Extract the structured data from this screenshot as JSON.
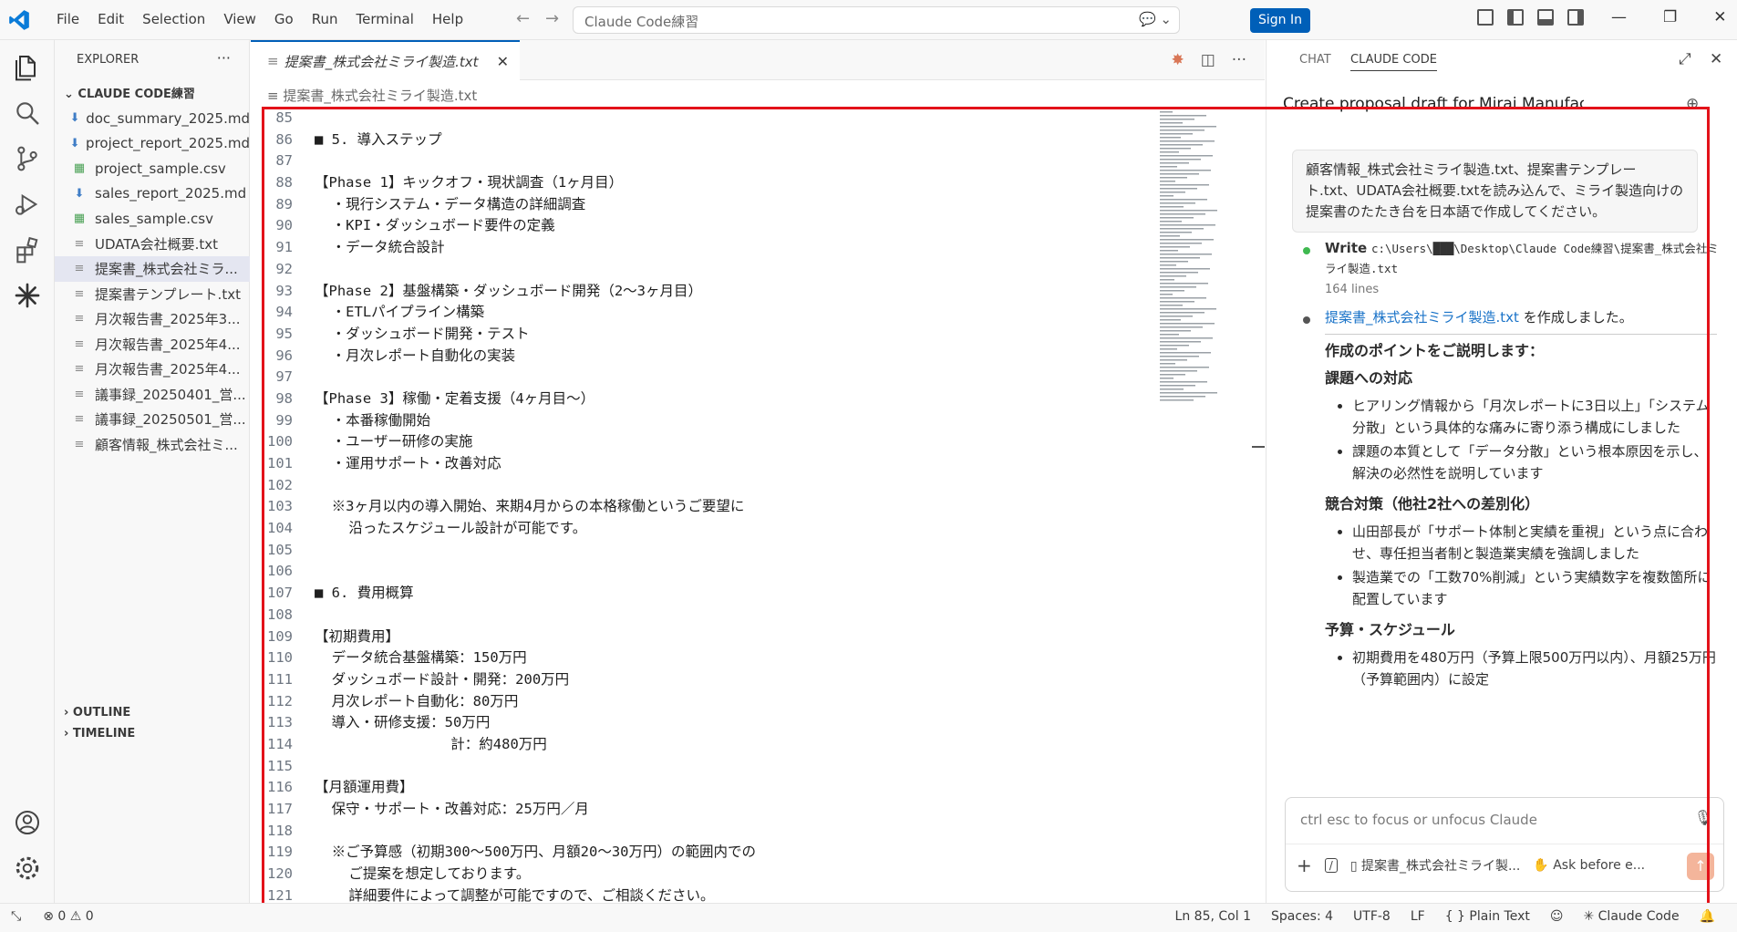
{
  "menu": [
    "File",
    "Edit",
    "Selection",
    "View",
    "Go",
    "Run",
    "Terminal",
    "Help"
  ],
  "search": {
    "text": "Claude Code練習"
  },
  "signin_label": "Sign In",
  "sidebar": {
    "title": "EXPLORER",
    "folder": "CLAUDE CODE練習",
    "files": [
      {
        "name": "doc_summary_2025.md",
        "type": "md"
      },
      {
        "name": "project_report_2025.md",
        "type": "md"
      },
      {
        "name": "project_sample.csv",
        "type": "csv"
      },
      {
        "name": "sales_report_2025.md",
        "type": "md"
      },
      {
        "name": "sales_sample.csv",
        "type": "csv"
      },
      {
        "name": "UDATA会社概要.txt",
        "type": "txt"
      },
      {
        "name": "提案書_株式会社ミラ...",
        "type": "txt",
        "selected": true
      },
      {
        "name": "提案書テンプレート.txt",
        "type": "txt"
      },
      {
        "name": "月次報告書_2025年3...",
        "type": "txt"
      },
      {
        "name": "月次報告書_2025年4...",
        "type": "txt"
      },
      {
        "name": "月次報告書_2025年4...",
        "type": "txt"
      },
      {
        "name": "議事録_20250401_営...",
        "type": "txt"
      },
      {
        "name": "議事録_20250501_営...",
        "type": "txt"
      },
      {
        "name": "顧客情報_株式会社ミ...",
        "type": "txt"
      }
    ],
    "outline": "OUTLINE",
    "timeline": "TIMELINE"
  },
  "editor": {
    "tab_label": "提案書_株式会社ミライ製造.txt",
    "breadcrumb": "提案書_株式会社ミライ製造.txt",
    "lines": [
      {
        "n": "85",
        "t": ""
      },
      {
        "n": "86",
        "t": "■ 5. 導入ステップ"
      },
      {
        "n": "87",
        "t": ""
      },
      {
        "n": "88",
        "t": "【Phase 1】キックオフ・現状調査（1ヶ月目）"
      },
      {
        "n": "89",
        "t": "  ・現行システム・データ構造の詳細調査"
      },
      {
        "n": "90",
        "t": "  ・KPI・ダッシュボード要件の定義"
      },
      {
        "n": "91",
        "t": "  ・データ統合設計"
      },
      {
        "n": "92",
        "t": ""
      },
      {
        "n": "93",
        "t": "【Phase 2】基盤構築・ダッシュボード開発（2〜3ヶ月目）"
      },
      {
        "n": "94",
        "t": "  ・ETLパイプライン構築"
      },
      {
        "n": "95",
        "t": "  ・ダッシュボード開発・テスト"
      },
      {
        "n": "96",
        "t": "  ・月次レポート自動化の実装"
      },
      {
        "n": "97",
        "t": ""
      },
      {
        "n": "98",
        "t": "【Phase 3】稼働・定着支援（4ヶ月目〜）"
      },
      {
        "n": "99",
        "t": "  ・本番稼働開始"
      },
      {
        "n": "100",
        "t": "  ・ユーザー研修の実施"
      },
      {
        "n": "101",
        "t": "  ・運用サポート・改善対応"
      },
      {
        "n": "102",
        "t": ""
      },
      {
        "n": "103",
        "t": "  ※3ヶ月以内の導入開始、来期4月からの本格稼働というご要望に"
      },
      {
        "n": "104",
        "t": "    沿ったスケジュール設計が可能です。"
      },
      {
        "n": "105",
        "t": ""
      },
      {
        "n": "106",
        "t": ""
      },
      {
        "n": "107",
        "t": "■ 6. 費用概算"
      },
      {
        "n": "108",
        "t": ""
      },
      {
        "n": "109",
        "t": "【初期費用】"
      },
      {
        "n": "110",
        "t": "  データ統合基盤構築：150万円"
      },
      {
        "n": "111",
        "t": "  ダッシュボード設計・開発：200万円"
      },
      {
        "n": "112",
        "t": "  月次レポート自動化：80万円"
      },
      {
        "n": "113",
        "t": "  導入・研修支援：50万円"
      },
      {
        "n": "114",
        "t": "                計：約480万円"
      },
      {
        "n": "115",
        "t": ""
      },
      {
        "n": "116",
        "t": "【月額運用費】"
      },
      {
        "n": "117",
        "t": "  保守・サポート・改善対応：25万円／月"
      },
      {
        "n": "118",
        "t": ""
      },
      {
        "n": "119",
        "t": "  ※ご予算感（初期300〜500万円、月額20〜30万円）の範囲内での"
      },
      {
        "n": "120",
        "t": "    ご提案を想定しております。"
      },
      {
        "n": "121",
        "t": "    詳細要件によって調整が可能ですので、ご相談ください。"
      }
    ]
  },
  "panel": {
    "tab_chat": "CHAT",
    "tab_claude": "CLAUDE CODE",
    "title": "Create proposal draft for Mirai Manufactur...",
    "user_message": "顧客情報_株式会社ミライ製造.txt、提案書テンプレート.txt、UDATA会社概要.txtを読み込んで、ミライ製造向けの提案書のたたき台を日本語で作成してください。",
    "tool_name": "Write",
    "tool_path": "c:\\Users\\███\\Desktop\\Claude Code練習\\提案書_株式会社ミライ製造.txt",
    "tool_lines": "164 lines",
    "created_link": "提案書_株式会社ミライ製造.txt",
    "created_suffix": " を作成しました。",
    "points_heading": "作成のポイントをご説明します：",
    "sections": [
      {
        "heading": "課題への対応",
        "items": [
          "ヒアリング情報から「月次レポートに3日以上」「システム分散」という具体的な痛みに寄り添う構成にしました",
          "課題の本質として「データ分散」という根本原因を示し、解決の必然性を説明しています"
        ]
      },
      {
        "heading": "競合対策（他社2社への差別化）",
        "items": [
          "山田部長が「サポート体制と実績を重視」という点に合わせ、専任担当者制と製造業実績を強調しました",
          "製造業での「工数70%削減」という実績数字を複数箇所に配置しています"
        ]
      },
      {
        "heading": "予算・スケジュール",
        "items": [
          "初期費用を480万円（予算上限500万円以内）、月額25万円（予算範囲内）に設定"
        ]
      }
    ],
    "input_placeholder": "ctrl esc to focus or unfocus Claude",
    "input_file_chip": "提案書_株式会社ミライ製...",
    "ask_mode": "Ask before e..."
  },
  "status": {
    "errors": "0",
    "warnings": "0",
    "position": "Ln 85, Col 1",
    "spaces": "Spaces: 4",
    "encoding": "UTF-8",
    "eol": "LF",
    "language": "Plain Text",
    "claude": "✳ Claude Code"
  },
  "colors": {
    "accent": "#005fb8",
    "highlight_box": "#e3121a",
    "claude_orange": "#d97757"
  }
}
